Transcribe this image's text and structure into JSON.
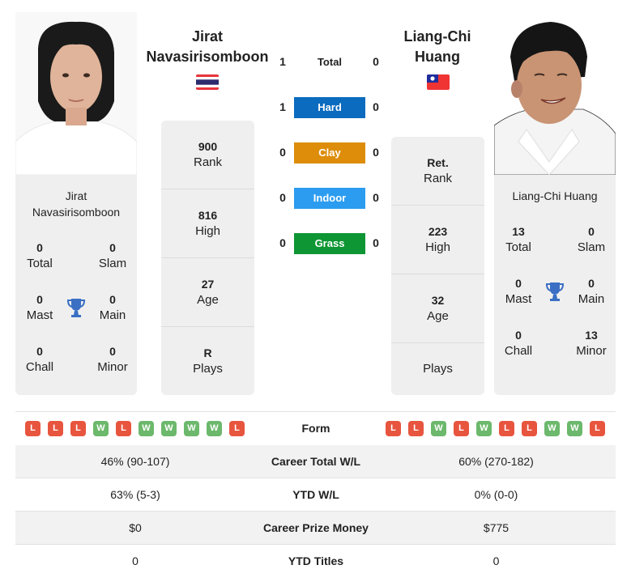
{
  "player1": {
    "name_line1": "Jirat",
    "name_line2": "Navasirisomboon",
    "full_name_line1": "Jirat",
    "full_name_line2": "Navasirisomboon",
    "flag": "thailand-flag",
    "stats": [
      {
        "value": "900",
        "label": "Rank"
      },
      {
        "value": "816",
        "label": "High"
      },
      {
        "value": "27",
        "label": "Age"
      },
      {
        "value": "R",
        "label": "Plays"
      }
    ],
    "titles": {
      "total": {
        "value": "0",
        "label": "Total"
      },
      "slam": {
        "value": "0",
        "label": "Slam"
      },
      "mast": {
        "value": "0",
        "label": "Mast"
      },
      "main": {
        "value": "0",
        "label": "Main"
      },
      "chall": {
        "value": "0",
        "label": "Chall"
      },
      "minor": {
        "value": "0",
        "label": "Minor"
      }
    },
    "form": [
      "L",
      "L",
      "L",
      "W",
      "L",
      "W",
      "W",
      "W",
      "W",
      "L"
    ]
  },
  "player2": {
    "name_line1": "Liang-Chi",
    "name_line2": "Huang",
    "full_name": "Liang-Chi Huang",
    "flag": "taiwan-flag",
    "stats": [
      {
        "value": "Ret.",
        "label": "Rank"
      },
      {
        "value": "223",
        "label": "High"
      },
      {
        "value": "32",
        "label": "Age"
      },
      {
        "value": "",
        "label": "Plays"
      }
    ],
    "titles": {
      "total": {
        "value": "13",
        "label": "Total"
      },
      "slam": {
        "value": "0",
        "label": "Slam"
      },
      "mast": {
        "value": "0",
        "label": "Mast"
      },
      "main": {
        "value": "0",
        "label": "Main"
      },
      "chall": {
        "value": "0",
        "label": "Chall"
      },
      "minor": {
        "value": "13",
        "label": "Minor"
      }
    },
    "form": [
      "L",
      "L",
      "W",
      "L",
      "W",
      "L",
      "L",
      "W",
      "W",
      "L"
    ]
  },
  "h2h": [
    {
      "label": "Total",
      "p1": "1",
      "p2": "0",
      "color": ""
    },
    {
      "label": "Hard",
      "p1": "1",
      "p2": "0",
      "color": "#0a6bbf"
    },
    {
      "label": "Clay",
      "p1": "0",
      "p2": "0",
      "color": "#dd8d0a"
    },
    {
      "label": "Indoor",
      "p1": "0",
      "p2": "0",
      "color": "#2b9cf0"
    },
    {
      "label": "Grass",
      "p1": "0",
      "p2": "0",
      "color": "#0e9634"
    }
  ],
  "form_label": "Form",
  "comparison": [
    {
      "label": "Career Total W/L",
      "p1": "46% (90-107)",
      "p2": "60% (270-182)"
    },
    {
      "label": "YTD W/L",
      "p1": "63% (5-3)",
      "p2": "0% (0-0)"
    },
    {
      "label": "Career Prize Money",
      "p1": "$0",
      "p2": "$775"
    },
    {
      "label": "YTD Titles",
      "p1": "0",
      "p2": "0"
    }
  ]
}
